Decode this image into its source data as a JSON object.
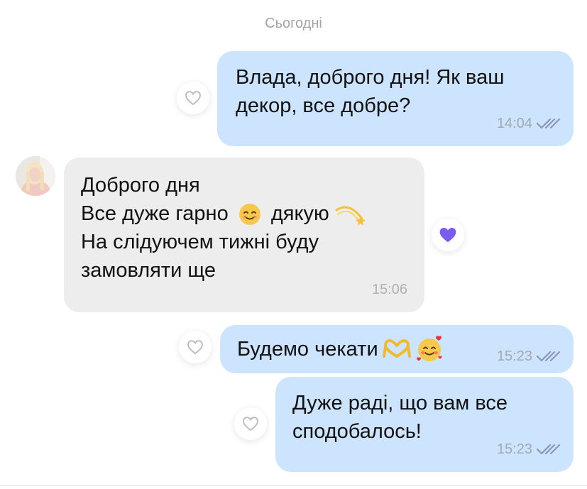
{
  "chat": {
    "date_separator": "Сьогодні",
    "messages": [
      {
        "direction": "out",
        "text": "Влада, доброго дня! Як ваш\nдекор, все добре?",
        "time": "14:04",
        "status": "read"
      },
      {
        "direction": "in",
        "line1": "Доброго дня",
        "line2a": "Все дуже гарно",
        "line2b": "дякую",
        "line3": "На слідуючем тижні буду",
        "line4": "замовляти ще",
        "time": "15:06",
        "reaction": "purple-heart"
      },
      {
        "direction": "out",
        "text": "Будемо чекати",
        "time": "15:23",
        "status": "read"
      },
      {
        "direction": "out",
        "text": "Дуже раді, що вам все\nсподобалось!",
        "time": "15:23",
        "status": "read"
      }
    ]
  },
  "colors": {
    "outgoing_bubble": "#cde4ff",
    "incoming_bubble": "#ededee",
    "reaction_heart": "#7b5cf0",
    "read_check": "#8a97b8"
  },
  "icons": [
    "heart-outline-icon",
    "purple-heart-icon",
    "double-check-icon",
    "smiling-face-icon",
    "dizzy-star-icon",
    "heart-hands-icon",
    "smiling-face-with-hearts-icon"
  ]
}
